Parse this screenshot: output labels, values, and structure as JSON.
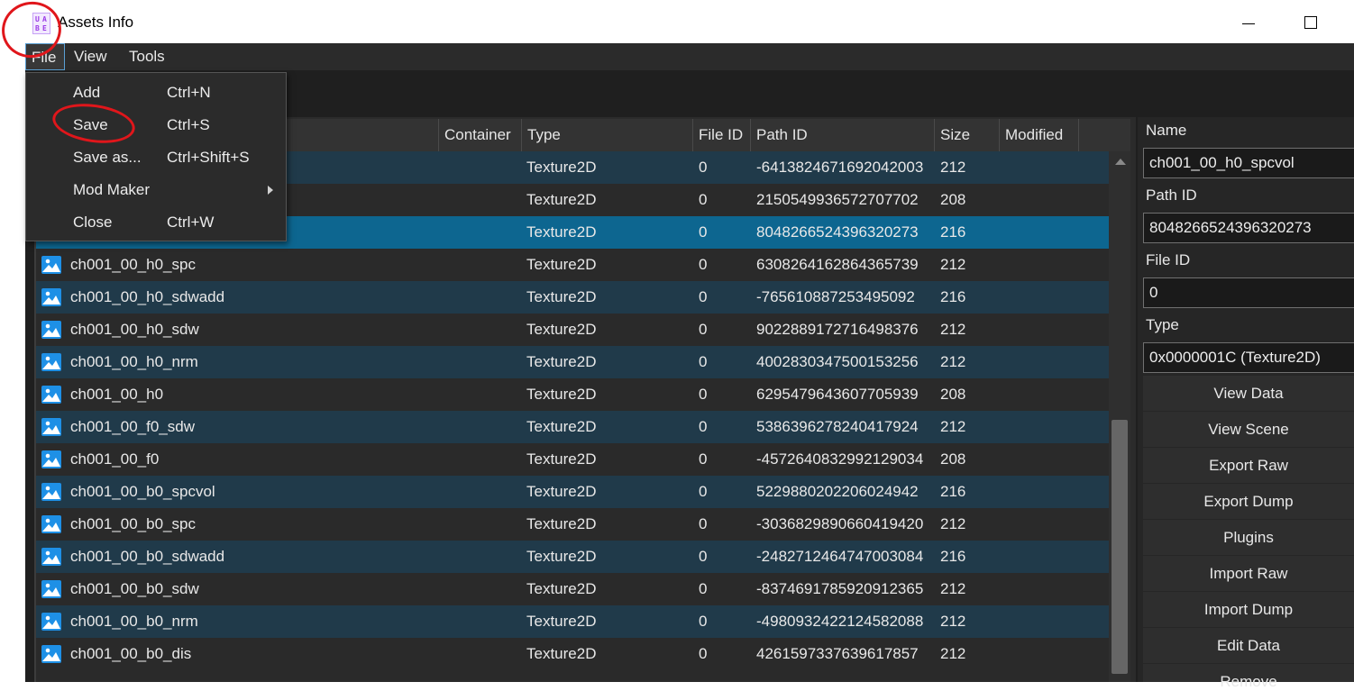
{
  "window": {
    "title": "Assets Info",
    "icon_letters": [
      "U",
      "A",
      "B",
      "E"
    ],
    "icon": "uabe-app-icon",
    "controls": [
      "minimize-icon",
      "maximize-icon"
    ]
  },
  "menubar": {
    "items": [
      "File",
      "View",
      "Tools"
    ]
  },
  "file_menu": {
    "items": [
      {
        "label": "Add",
        "shortcut": "Ctrl+N"
      },
      {
        "label": "Save",
        "shortcut": "Ctrl+S"
      },
      {
        "label": "Save as...",
        "shortcut": "Ctrl+Shift+S"
      },
      {
        "label": "Mod Maker",
        "shortcut": "",
        "submenu": true
      },
      {
        "label": "Close",
        "shortcut": "Ctrl+W"
      }
    ]
  },
  "table": {
    "columns": [
      "Container",
      "Type",
      "File ID",
      "Path ID",
      "Size",
      "Modified"
    ],
    "rows": [
      {
        "name": "",
        "type": "Texture2D",
        "file_id": "0",
        "path_id": "-6413824671692042003",
        "size": "212"
      },
      {
        "name": "",
        "type": "Texture2D",
        "file_id": "0",
        "path_id": "2150549936572707702",
        "size": "208"
      },
      {
        "name": "",
        "type": "Texture2D",
        "file_id": "0",
        "path_id": "8048266524396320273",
        "size": "216",
        "selected": true
      },
      {
        "name": "ch001_00_h0_spc",
        "type": "Texture2D",
        "file_id": "0",
        "path_id": "6308264162864365739",
        "size": "212"
      },
      {
        "name": "ch001_00_h0_sdwadd",
        "type": "Texture2D",
        "file_id": "0",
        "path_id": "-765610887253495092",
        "size": "216"
      },
      {
        "name": "ch001_00_h0_sdw",
        "type": "Texture2D",
        "file_id": "0",
        "path_id": "9022889172716498376",
        "size": "212"
      },
      {
        "name": "ch001_00_h0_nrm",
        "type": "Texture2D",
        "file_id": "0",
        "path_id": "4002830347500153256",
        "size": "212"
      },
      {
        "name": "ch001_00_h0",
        "type": "Texture2D",
        "file_id": "0",
        "path_id": "6295479643607705939",
        "size": "208"
      },
      {
        "name": "ch001_00_f0_sdw",
        "type": "Texture2D",
        "file_id": "0",
        "path_id": "5386396278240417924",
        "size": "212"
      },
      {
        "name": "ch001_00_f0",
        "type": "Texture2D",
        "file_id": "0",
        "path_id": "-4572640832992129034",
        "size": "208"
      },
      {
        "name": "ch001_00_b0_spcvol",
        "type": "Texture2D",
        "file_id": "0",
        "path_id": "5229880202206024942",
        "size": "216"
      },
      {
        "name": "ch001_00_b0_spc",
        "type": "Texture2D",
        "file_id": "0",
        "path_id": "-3036829890660419420",
        "size": "212"
      },
      {
        "name": "ch001_00_b0_sdwadd",
        "type": "Texture2D",
        "file_id": "0",
        "path_id": "-2482712464747003084",
        "size": "216"
      },
      {
        "name": "ch001_00_b0_sdw",
        "type": "Texture2D",
        "file_id": "0",
        "path_id": "-8374691785920912365",
        "size": "212"
      },
      {
        "name": "ch001_00_b0_nrm",
        "type": "Texture2D",
        "file_id": "0",
        "path_id": "-4980932422124582088",
        "size": "212"
      },
      {
        "name": "ch001_00_b0_dis",
        "type": "Texture2D",
        "file_id": "0",
        "path_id": "4261597337639617857",
        "size": "212"
      }
    ],
    "row_icon": "image-icon"
  },
  "details": {
    "name_label": "Name",
    "name_value": "ch001_00_h0_spcvol",
    "pathid_label": "Path ID",
    "pathid_value": "8048266524396320273",
    "fileid_label": "File ID",
    "fileid_value": "0",
    "type_label": "Type",
    "type_value": "0x0000001C (Texture2D)",
    "buttons": [
      "View Data",
      "View Scene",
      "Export Raw",
      "Export Dump",
      "Plugins",
      "Import Raw",
      "Import Dump",
      "Edit Data",
      "Remove"
    ]
  },
  "colors": {
    "selected_row": "#0d6690",
    "alt_row": "#203a4a",
    "annotation": "#e0161b",
    "icon_blue": "#1e90e6"
  }
}
